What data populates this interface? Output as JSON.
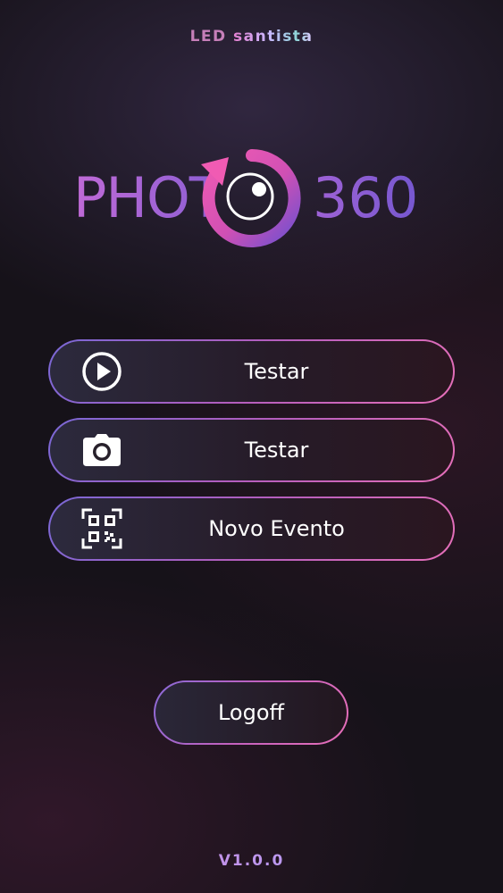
{
  "header": {
    "brand_led": "LED",
    "brand_santista": "santista"
  },
  "logo": {
    "text_left": "PHOT",
    "text_right": "360",
    "colors": {
      "text_gradient_start": "#b46bd6",
      "text_gradient_end": "#7d5ad0",
      "ring_pink": "#e354ad",
      "ring_purple": "#7a52d0"
    }
  },
  "menu": {
    "items": [
      {
        "label": "Testar",
        "icon": "play-circle-icon"
      },
      {
        "label": "Testar",
        "icon": "camera-icon"
      },
      {
        "label": "Novo Evento",
        "icon": "qr-code-icon"
      }
    ]
  },
  "logoff": {
    "label": "Logoff"
  },
  "footer": {
    "version": "V1.0.0"
  },
  "theme": {
    "background": "#161219",
    "button_border_start": "#7a68d6",
    "button_border_end": "#e66fb9"
  }
}
